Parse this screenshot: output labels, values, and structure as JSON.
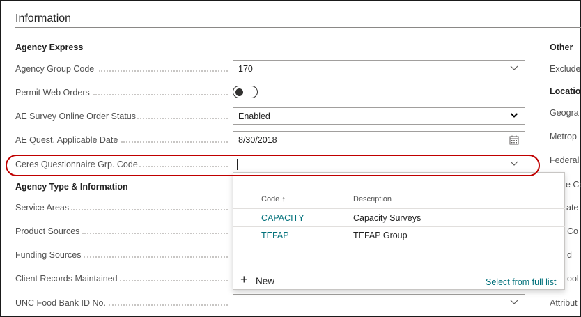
{
  "section": {
    "title": "Information"
  },
  "agency_express": {
    "title": "Agency Express",
    "fields": {
      "agency_group_code": {
        "label": "Agency Group Code",
        "value": "170"
      },
      "permit_web_orders": {
        "label": "Permit Web Orders",
        "checked": false
      },
      "ae_survey_status": {
        "label": "AE Survey Online Order Status",
        "value": "Enabled"
      },
      "ae_quest_date": {
        "label": "AE Quest. Applicable Date",
        "value": "8/30/2018"
      },
      "ceres_code": {
        "label": "Ceres Questionnaire Grp. Code",
        "value": ""
      }
    }
  },
  "agency_type": {
    "title": "Agency Type & Information",
    "fields": {
      "service_areas": {
        "label": "Service Areas"
      },
      "product_sources": {
        "label": "Product Sources"
      },
      "funding_sources": {
        "label": "Funding Sources"
      },
      "client_records": {
        "label": "Client Records Maintained"
      },
      "unc_food_bank": {
        "label": "UNC Food Bank ID No.",
        "value": ""
      }
    }
  },
  "lookup": {
    "col_code": "Code ↑",
    "col_desc": "Description",
    "rows": [
      {
        "code": "CAPACITY",
        "description": "Capacity Surveys"
      },
      {
        "code": "TEFAP",
        "description": "TEFAP Group"
      }
    ],
    "new_label": "New",
    "new_icon": "+",
    "select_full_list": "Select from full list"
  },
  "right_column": {
    "other_title": "Other",
    "exclude_label": "Exclude",
    "location_title": "Locatio",
    "geogra_label": "Geogra",
    "metrop_label": "Metrop",
    "federal_label": "Federal",
    "c_co_label": "e Co",
    "state_label": "ate",
    "co2_label": "Co",
    "d_label": "d",
    "ool_label": "ool",
    "attribut_label": "Attribut"
  },
  "colors": {
    "accent": "#00707a",
    "highlight": "#c00000"
  }
}
